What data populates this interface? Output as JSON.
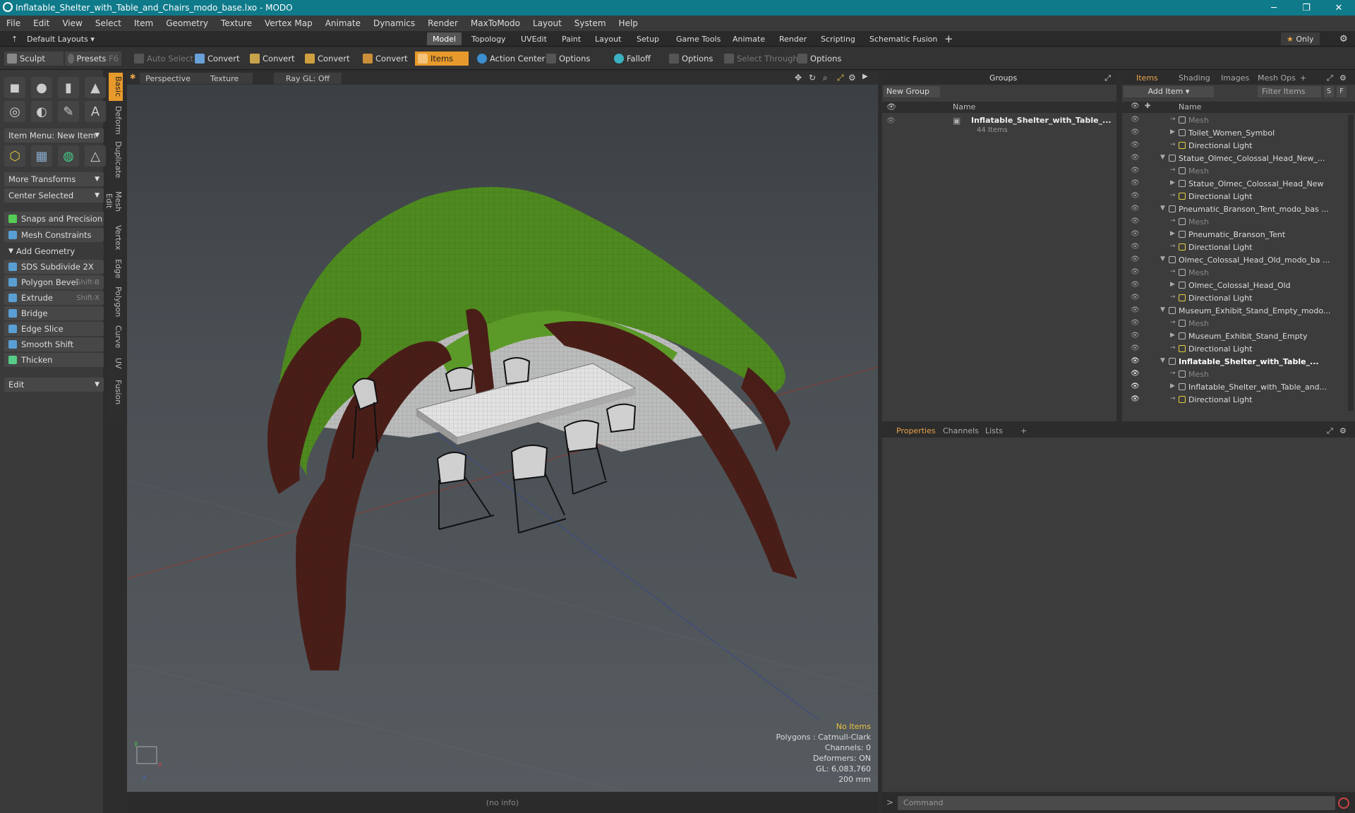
{
  "window": {
    "title": "Inflatable_Shelter_with_Table_and_Chairs_modo_base.lxo - MODO"
  },
  "menu": [
    "File",
    "Edit",
    "View",
    "Select",
    "Item",
    "Geometry",
    "Texture",
    "Vertex Map",
    "Animate",
    "Dynamics",
    "Render",
    "MaxToModo",
    "Layout",
    "System",
    "Help"
  ],
  "layouts": {
    "default": "Default Layouts",
    "tabs": [
      "Model",
      "Topology",
      "UVEdit",
      "Paint",
      "Layout",
      "Setup",
      "Game Tools",
      "Animate",
      "Render",
      "Scripting",
      "Schematic Fusion"
    ],
    "active": "Model",
    "only": "Only"
  },
  "toolbar": {
    "sculpt": "Sculpt",
    "presets": "Presets",
    "presets_key": "F6",
    "auto_select": "Auto Select",
    "convert1": "Convert",
    "convert2": "Convert",
    "convert3": "Convert",
    "convert4": "Convert",
    "items": "Items",
    "action_center": "Action Center",
    "options1": "Options",
    "falloff": "Falloff",
    "options2": "Options",
    "select_through": "Select Through",
    "options3": "Options"
  },
  "left": {
    "item_menu": "Item Menu: New Item",
    "more_transforms": "More Transforms",
    "center_selected": "Center Selected",
    "snaps": "Snaps and Precision",
    "mesh_constraints": "Mesh Constraints",
    "add_geometry": "Add Geometry",
    "tools": [
      {
        "label": "SDS Subdivide 2X",
        "key": ""
      },
      {
        "label": "Polygon Bevel",
        "key": "Shift-B"
      },
      {
        "label": "Extrude",
        "key": "Shift-X"
      },
      {
        "label": "Bridge",
        "key": ""
      },
      {
        "label": "Edge Slice",
        "key": ""
      },
      {
        "label": "Smooth Shift",
        "key": ""
      },
      {
        "label": "Thicken",
        "key": ""
      }
    ],
    "edit": "Edit"
  },
  "sidetabs": [
    "Basic",
    "Deform",
    "Duplicate",
    "Mesh Edit",
    "Vertex",
    "Edge",
    "Polygon",
    "Curve",
    "UV",
    "Fusion"
  ],
  "viewport": {
    "perspective": "Perspective",
    "texture": "Texture",
    "raygl": "Ray GL: Off",
    "info": {
      "items": "No Items",
      "polygons": "Polygons : Catmull-Clark",
      "channels": "Channels: 0",
      "deformers": "Deformers: ON",
      "gl": "GL: 6,083,760",
      "scale": "200 mm"
    },
    "status": "(no info)"
  },
  "groups": {
    "title": "Groups",
    "new_group": "New Group",
    "col_name": "Name",
    "entry": "Inflatable_Shelter_with_Table_...",
    "count": "44 Items"
  },
  "items": {
    "tabs": [
      "Items",
      "Shading",
      "Images",
      "Mesh Ops"
    ],
    "add_item": "Add Item",
    "filter": "Filter Items",
    "col_name": "Name",
    "rows": [
      {
        "label": "Mesh",
        "level": 2,
        "kind": "mesh"
      },
      {
        "label": "Toilet_Women_Symbol",
        "level": 2,
        "kind": "item"
      },
      {
        "label": "Directional Light",
        "level": 2,
        "kind": "light"
      },
      {
        "label": "Statue_Olmec_Colossal_Head_New_...",
        "level": 1,
        "kind": "scene"
      },
      {
        "label": "Mesh",
        "level": 2,
        "kind": "mesh"
      },
      {
        "label": "Statue_Olmec_Colossal_Head_New",
        "level": 2,
        "kind": "item"
      },
      {
        "label": "Directional Light",
        "level": 2,
        "kind": "light"
      },
      {
        "label": "Pneumatic_Branson_Tent_modo_bas ...",
        "level": 1,
        "kind": "scene"
      },
      {
        "label": "Mesh",
        "level": 2,
        "kind": "mesh"
      },
      {
        "label": "Pneumatic_Branson_Tent",
        "level": 2,
        "kind": "item"
      },
      {
        "label": "Directional Light",
        "level": 2,
        "kind": "light"
      },
      {
        "label": "Olmec_Colossal_Head_Old_modo_ba ...",
        "level": 1,
        "kind": "scene"
      },
      {
        "label": "Mesh",
        "level": 2,
        "kind": "mesh"
      },
      {
        "label": "Olmec_Colossal_Head_Old",
        "level": 2,
        "kind": "item"
      },
      {
        "label": "Directional Light",
        "level": 2,
        "kind": "light"
      },
      {
        "label": "Museum_Exhibit_Stand_Empty_modo...",
        "level": 1,
        "kind": "scene"
      },
      {
        "label": "Mesh",
        "level": 2,
        "kind": "mesh"
      },
      {
        "label": "Museum_Exhibit_Stand_Empty",
        "level": 2,
        "kind": "item"
      },
      {
        "label": "Directional Light",
        "level": 2,
        "kind": "light"
      },
      {
        "label": "Inflatable_Shelter_with_Table_...",
        "level": 1,
        "kind": "scene-sel"
      },
      {
        "label": "Mesh",
        "level": 2,
        "kind": "mesh"
      },
      {
        "label": "Inflatable_Shelter_with_Table_and...",
        "level": 2,
        "kind": "item"
      },
      {
        "label": "Directional Light",
        "level": 2,
        "kind": "light"
      }
    ]
  },
  "props": {
    "tabs": [
      "Properties",
      "Channels",
      "Lists"
    ]
  },
  "command": {
    "placeholder": "Command"
  },
  "colors": {
    "accent": "#e79a2b",
    "title": "#0e7a8a",
    "tent_green": "#4e8a1f",
    "tent_brown": "#4a1e18"
  }
}
